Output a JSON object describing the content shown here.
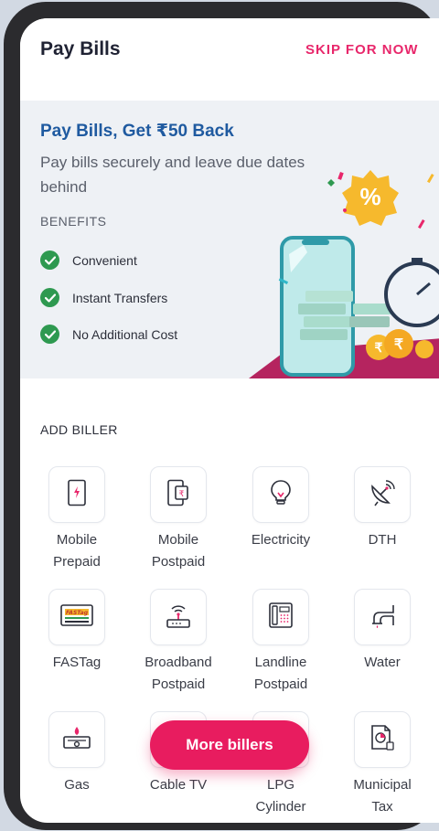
{
  "header": {
    "title": "Pay Bills",
    "skip_label": "SKIP FOR NOW"
  },
  "promo": {
    "title": "Pay Bills, Get ₹50 Back",
    "subtitle": "Pay bills securely and leave due dates behind",
    "benefits_label": "BENEFITS",
    "benefits": [
      "Convenient",
      "Instant Transfers",
      "No Additional Cost"
    ]
  },
  "billers": {
    "section_label": "ADD BILLER",
    "items": [
      {
        "line1": "Mobile",
        "line2": "Prepaid",
        "icon": "mobile-prepaid-icon"
      },
      {
        "line1": "Mobile",
        "line2": "Postpaid",
        "icon": "mobile-postpaid-icon"
      },
      {
        "line1": "Electricity",
        "line2": "",
        "icon": "bulb-icon"
      },
      {
        "line1": "DTH",
        "line2": "",
        "icon": "satellite-dish-icon"
      },
      {
        "line1": "FASTag",
        "line2": "",
        "icon": "fastag-card-icon"
      },
      {
        "line1": "Broadband",
        "line2": "Postpaid",
        "icon": "router-icon"
      },
      {
        "line1": "Landline",
        "line2": "Postpaid",
        "icon": "landline-phone-icon"
      },
      {
        "line1": "Water",
        "line2": "",
        "icon": "water-tap-icon"
      },
      {
        "line1": "Gas",
        "line2": "",
        "icon": "gas-stove-icon"
      },
      {
        "line1": "Cable TV",
        "line2": "",
        "icon": "tv-icon"
      },
      {
        "line1": "LPG",
        "line2": "Cylinder",
        "icon": "lpg-cylinder-icon"
      },
      {
        "line1": "Municipal",
        "line2": "Tax",
        "icon": "municipal-tax-icon"
      }
    ]
  },
  "fastag_logo_text": "FASTag",
  "more_billers_label": "More billers",
  "colors": {
    "accent": "#e81c5f",
    "promo_title": "#1f5aa0",
    "check": "#2e9950"
  }
}
